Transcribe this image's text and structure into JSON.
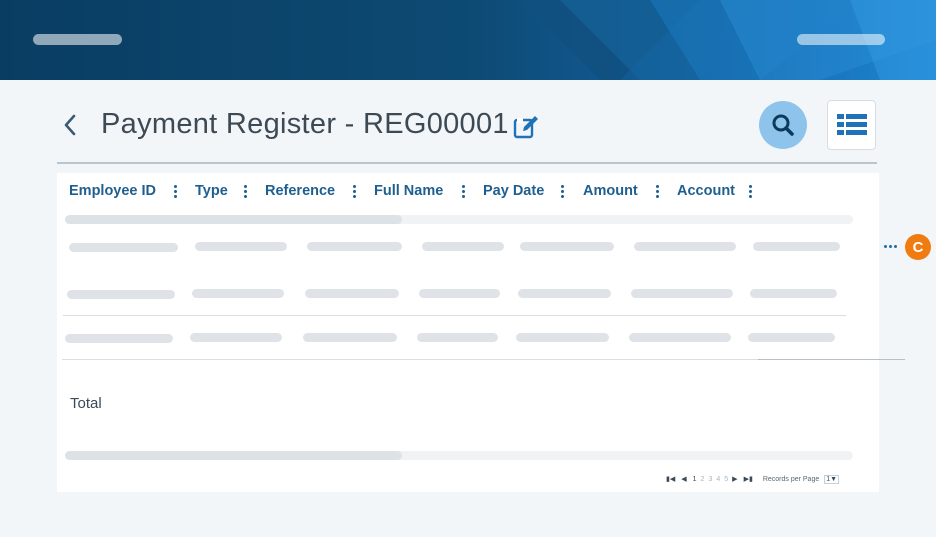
{
  "header": {
    "title": "Payment Register - REG00001",
    "icons": [
      "back-chevron-icon",
      "edit-icon",
      "search-icon",
      "list-view-icon"
    ]
  },
  "table": {
    "columns": [
      "Employee ID",
      "Type",
      "Reference",
      "Full Name",
      "Pay Date",
      "Amount",
      "Account"
    ],
    "total_label": "Total"
  },
  "pager": {
    "pages": [
      "1",
      "2",
      "3",
      "4",
      "5"
    ],
    "current_page": "1",
    "records_label": "Records per Page",
    "records_value": "1"
  },
  "badge": {
    "letter": "C"
  },
  "colors": {
    "banner_dark": "#0a3d62",
    "banner_light": "#1e88d6",
    "accent_text": "#1f5f8f",
    "search_button": "#8ec4ec",
    "badge": "#f07c11"
  }
}
